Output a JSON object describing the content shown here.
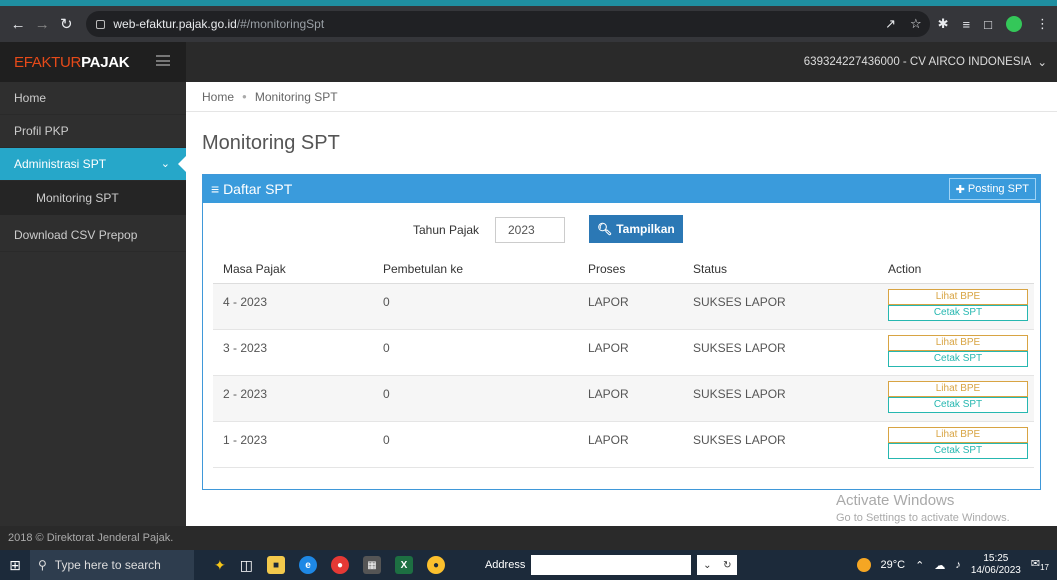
{
  "browser": {
    "url_host": "web-efaktur.pajak.go.id",
    "url_path": "/#/monitoringSpt"
  },
  "app": {
    "logo_part1": "EFAKTUR",
    "logo_part2": "PAJAK",
    "user_label": "639324227436000 - CV AIRCO INDONESIA"
  },
  "sidebar": {
    "items": [
      {
        "label": "Home"
      },
      {
        "label": "Profil PKP"
      },
      {
        "label": "Administrasi SPT"
      },
      {
        "label": "Monitoring SPT"
      },
      {
        "label": "Download CSV Prepop"
      }
    ]
  },
  "breadcrumb": [
    "Home",
    "Monitoring SPT"
  ],
  "page_title": "Monitoring SPT",
  "panel": {
    "title": "Daftar SPT",
    "posting_label": "Posting SPT",
    "filter_label": "Tahun Pajak",
    "year_value": "2023",
    "show_label": "Tampilkan"
  },
  "table": {
    "headers": [
      "Masa Pajak",
      "Pembetulan ke",
      "Proses",
      "Status",
      "Action"
    ],
    "rows": [
      {
        "masa": "4 - 2023",
        "pembetulan": "0",
        "proses": "LAPOR",
        "status": "SUKSES LAPOR"
      },
      {
        "masa": "3 - 2023",
        "pembetulan": "0",
        "proses": "LAPOR",
        "status": "SUKSES LAPOR"
      },
      {
        "masa": "2 - 2023",
        "pembetulan": "0",
        "proses": "LAPOR",
        "status": "SUKSES LAPOR"
      },
      {
        "masa": "1 - 2023",
        "pembetulan": "0",
        "proses": "LAPOR",
        "status": "SUKSES LAPOR"
      }
    ],
    "action_bpe": "Lihat BPE",
    "action_cetak": "Cetak SPT"
  },
  "footer": "2018 © Direktorat Jenderal Pajak.",
  "watermark": {
    "line1": "Activate Windows",
    "line2": "Go to Settings to activate Windows."
  },
  "taskbar": {
    "search_placeholder": "Type here to search",
    "address_label": "Address",
    "temperature": "29°C",
    "time": "15:25",
    "date": "14/06/2023",
    "notification_count": "17"
  }
}
